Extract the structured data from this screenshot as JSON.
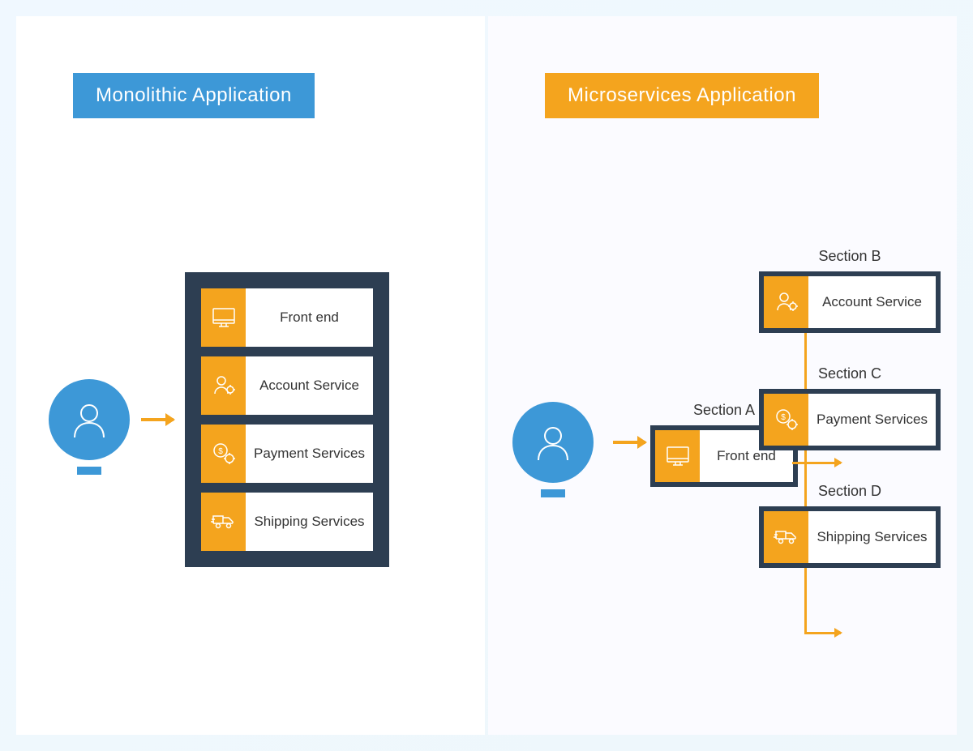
{
  "left": {
    "title": "Monolithic Application",
    "services": [
      {
        "id": "frontend",
        "label": "Front end",
        "icon": "monitor"
      },
      {
        "id": "account",
        "label": "Account Service",
        "icon": "user-gear"
      },
      {
        "id": "payment",
        "label": "Payment Services",
        "icon": "money-gear"
      },
      {
        "id": "shipping",
        "label": "Shipping Services",
        "icon": "truck"
      }
    ]
  },
  "right": {
    "title": "Microservices Application",
    "sectionA": {
      "label": "Section A",
      "service": {
        "id": "frontend",
        "label": "Front end",
        "icon": "monitor"
      }
    },
    "services": [
      {
        "section": "Section B",
        "id": "account",
        "label": "Account Service",
        "icon": "user-gear"
      },
      {
        "section": "Section C",
        "id": "payment",
        "label": "Payment Services",
        "icon": "money-gear"
      },
      {
        "section": "Section D",
        "id": "shipping",
        "label": "Shipping Services",
        "icon": "truck"
      }
    ]
  },
  "colors": {
    "blue": "#3d98d7",
    "orange": "#f4a41e",
    "navy": "#2d3e52"
  }
}
